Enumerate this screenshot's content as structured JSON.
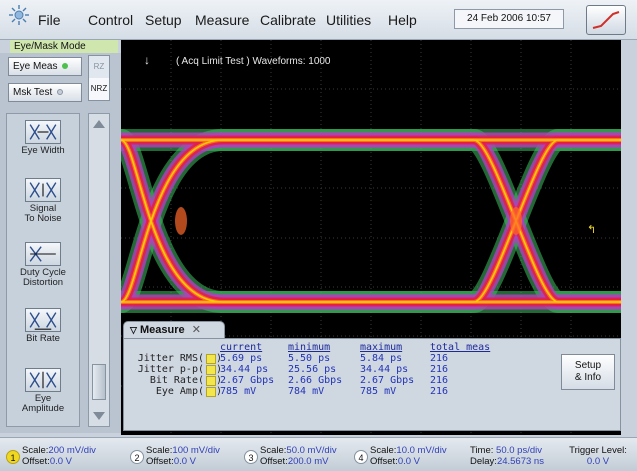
{
  "menu": {
    "items": [
      "File",
      "Control",
      "Setup",
      "Measure",
      "Calibrate",
      "Utilities",
      "Help"
    ],
    "datetime": "24 Feb 2006  10:57"
  },
  "mode_label": "Eye/Mask Mode",
  "left_panel": {
    "eye_meas_label": "Eye Meas",
    "msk_test_label": "Msk Test",
    "toggle_options": [
      "RZ",
      "NRZ"
    ],
    "measurements": [
      "Eye Width",
      "Signal\nTo Noise",
      "Duty Cycle\nDistortion",
      "Bit Rate",
      "Eye\nAmplitude"
    ]
  },
  "display": {
    "acq_status": "( Acq Limit Test )  Waveforms: 1000"
  },
  "measure_panel": {
    "tab_label": "Measure",
    "headers": [
      "current",
      "minimum",
      "maximum",
      "total meas"
    ],
    "rows": [
      {
        "label": "Jitter RMS(",
        "current": "5.69 ps",
        "minimum": "5.50 ps",
        "maximum": "5.84 ps",
        "total": "216"
      },
      {
        "label": "Jitter p-p(",
        "current": "34.44 ps",
        "minimum": "25.56 ps",
        "maximum": "34.44 ps",
        "total": "216"
      },
      {
        "label": "Bit Rate(",
        "current": "2.67 Gbps",
        "minimum": "2.66 Gbps",
        "maximum": "2.67 Gbps",
        "total": "216"
      },
      {
        "label": "Eye Amp(",
        "current": "785 mV",
        "minimum": "784 mV",
        "maximum": "785 mV",
        "total": "216"
      }
    ],
    "row_suffix": ")",
    "setup_info_line1": "Setup",
    "setup_info_line2": "& Info"
  },
  "channels": [
    {
      "num": "1",
      "scale_label": "Scale:",
      "scale": "200 mV/div",
      "offset_label": "Offset:",
      "offset": "0.0 V",
      "color": "#f0d820"
    },
    {
      "num": "2",
      "scale_label": "Scale:",
      "scale": "100 mV/div",
      "offset_label": "Offset:",
      "offset": "0.0 V",
      "color": "#ffffff"
    },
    {
      "num": "3",
      "scale_label": "Scale:",
      "scale": "50.0 mV/div",
      "offset_label": "Offset:",
      "offset": "200.0 mV",
      "color": "#ffffff"
    },
    {
      "num": "4",
      "scale_label": "Scale:",
      "scale": "10.0 mV/div",
      "offset_label": "Offset:",
      "offset": "0.0 V",
      "color": "#ffffff"
    }
  ],
  "timebase": {
    "time_label": "Time:",
    "time": "50.0 ps/div",
    "delay_label": "Delay:",
    "delay": "24.5673 ns"
  },
  "trigger": {
    "label": "Trigger Level:",
    "value": "0.0 V"
  },
  "colors": {
    "display_bg": "#000000",
    "trace_hot": "#ffcc00",
    "trace_warm": "#ff6a2a",
    "trace_red": "#e0204a",
    "trace_magenta": "#b040c0",
    "trace_green": "#40c060",
    "value_blue": "#2233b8"
  }
}
